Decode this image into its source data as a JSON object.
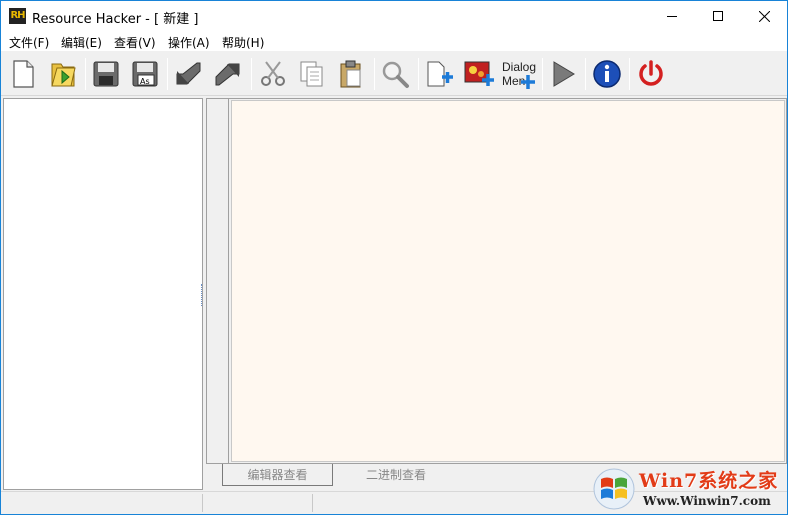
{
  "window": {
    "title": "Resource Hacker - [ 新建 ]",
    "app_icon_text": "RH"
  },
  "menu": {
    "items": [
      "文件(F)",
      "编辑(E)",
      "查看(V)",
      "操作(A)",
      "帮助(H)"
    ]
  },
  "toolbar": {
    "dialog_label": "Dialog",
    "menu_label": "Men",
    "buttons": [
      "new-file",
      "open-file",
      "save",
      "save-as",
      "compile-back",
      "compile-forward",
      "cut",
      "copy",
      "paste",
      "find",
      "add-resource",
      "add-image",
      "dialog-menu-editor",
      "run-script",
      "about",
      "exit"
    ]
  },
  "tabs": {
    "editor_view": "编辑器查看",
    "binary_view": "二进制查看"
  },
  "watermark": {
    "title": "Win7系统之家",
    "url": "Www.Winwin7.com"
  },
  "colors": {
    "title_accent": "#1883d7",
    "editor_bg": "#fff8f0",
    "watermark_red": "#e23b17"
  }
}
